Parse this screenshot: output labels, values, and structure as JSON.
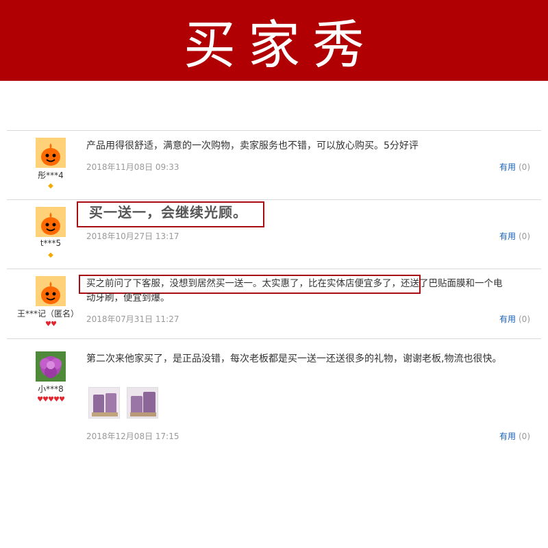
{
  "banner": {
    "title": "买家秀"
  },
  "reviews": [
    {
      "username": "彤***4",
      "level": "yellow-diamond-1",
      "content": "产品用得很舒适，满意的一次购物，卖家服务也不错，可以放心购买。5分好评",
      "date": "2018年11月08日 09:33",
      "useful_label": "有用",
      "useful_count": "(0)"
    },
    {
      "username": "t***5",
      "level": "yellow-diamond-1",
      "content": "买一送一，会继续光顾。",
      "date": "2018年10月27日 13:17",
      "useful_label": "有用",
      "useful_count": "(0)"
    },
    {
      "username": "王***记（匿名）",
      "level": "red-heart-2",
      "content_part1": "买之前问了下客服，没想到居然买一送一。太实惠了，比在实体店便宜多了，",
      "content_part2": "还送了巴贴面膜和一个电",
      "content_line2": "动牙刷，便宜到爆。",
      "date": "2018年07月31日 11:27",
      "useful_label": "有用",
      "useful_count": "(0)"
    },
    {
      "username": "小***8",
      "level": "red-heart-5",
      "content": "第二次来他家买了，是正品没错，每次老板都是买一送一还送很多的礼物，谢谢老板,物流也很快。",
      "date": "2018年12月08日 17:15",
      "useful_label": "有用",
      "useful_count": "(0)"
    }
  ],
  "icons": {
    "avatar_default": "orange-mascot-icon",
    "avatar_flower": "purple-flower-avatar",
    "level_yellow": "yellow-diamond-icon",
    "level_red": "red-heart-icon"
  },
  "colors": {
    "banner": "#b00004",
    "highlight_border": "#a80b12",
    "link": "#1a62b5",
    "date": "#999999"
  }
}
